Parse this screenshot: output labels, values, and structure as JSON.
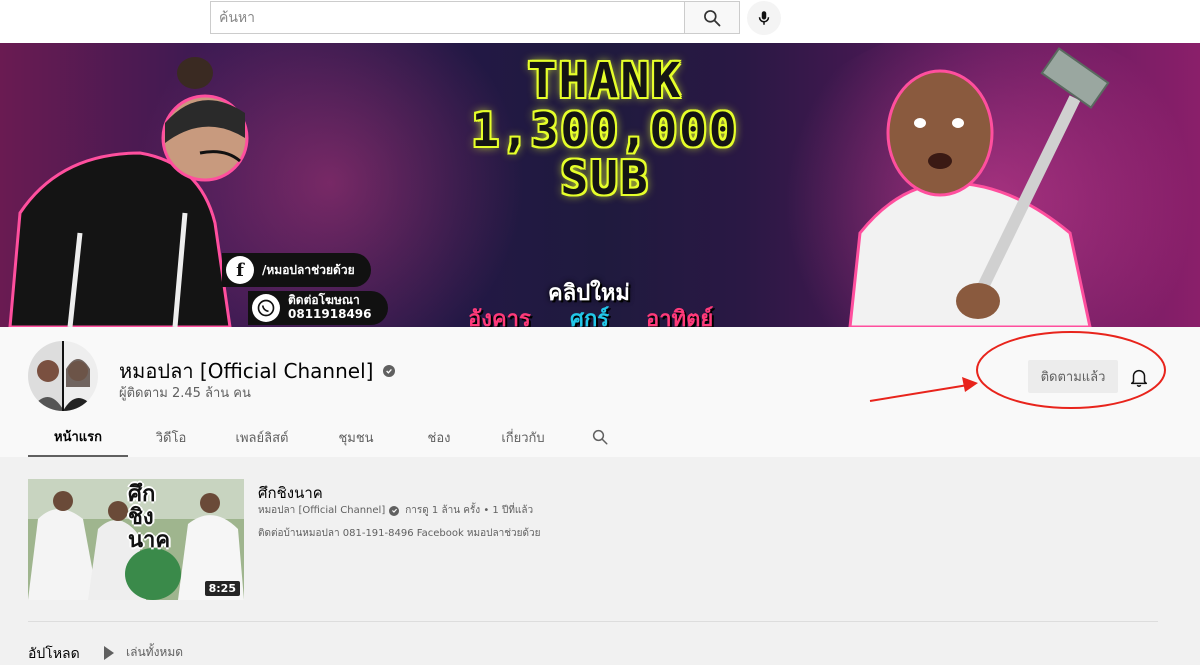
{
  "search": {
    "placeholder": "ค้นหา"
  },
  "banner": {
    "thanks_line1": "THANK",
    "thanks_line2": "1,300,000",
    "thanks_line3": "SUB",
    "facebook": "/หมอปลาช่วยด้วย",
    "whatsapp_line1": "ติดต่อโฆษณา",
    "whatsapp_line2": "0811918496",
    "schedule_title": "คลิปใหม่",
    "days": [
      "อังคาร",
      "ศุกร์",
      "อาทิตย์"
    ]
  },
  "channel": {
    "name": "หมอปลา [Official Channel]",
    "subscribers": "ผู้ติดตาม 2.45 ล้าน คน",
    "subscribe_label": "ติดตามแล้ว"
  },
  "tabs": [
    "หน้าแรก",
    "วิดีโอ",
    "เพลย์ลิสต์",
    "ชุมชน",
    "ช่อง",
    "เกี่ยวกับ"
  ],
  "featured": {
    "title": "ศึกชิงนาค",
    "channel": "หมอปลา [Official Channel]",
    "stats": "การดู 1 ล้าน ครั้ง • 1 ปีที่แล้ว",
    "description": "ติดต่อบ้านหมอปลา 081-191-8496 Facebook หมอปลาช่วยด้วย",
    "duration": "8:25",
    "thumb_text": [
      "ศึก",
      "ชิง",
      "นาค"
    ]
  },
  "uploads": {
    "title": "อัปโหลด",
    "play_all": "เล่นทั้งหมด"
  },
  "colors": {
    "annotation": "#e8241c",
    "accent": "#e6ff2a"
  }
}
